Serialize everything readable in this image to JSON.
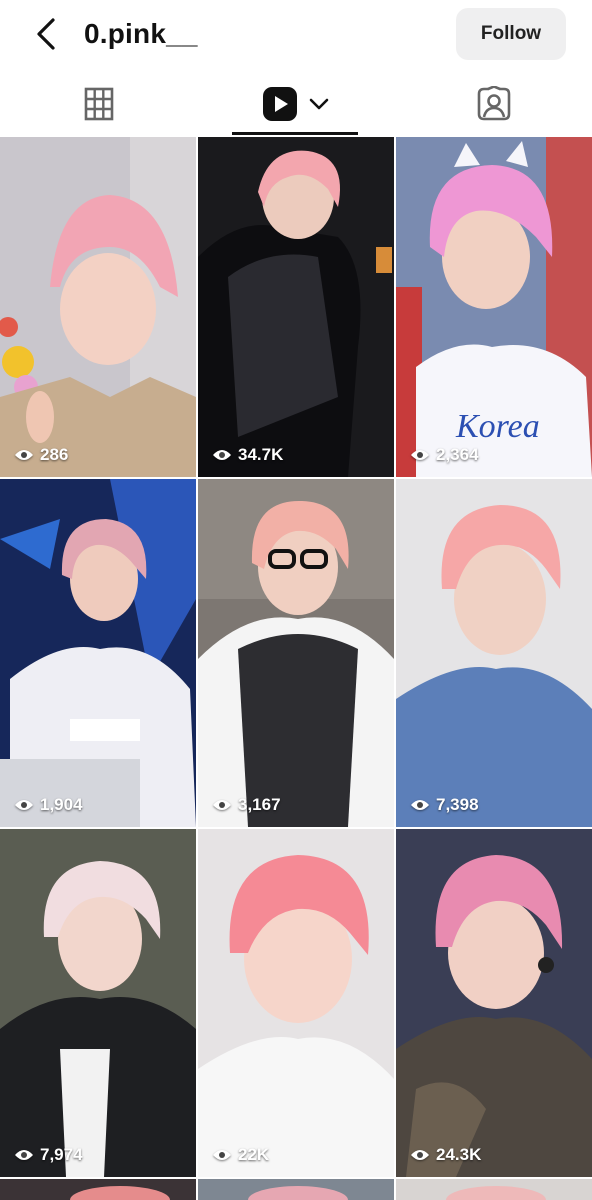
{
  "header": {
    "username": "0.pink__",
    "follow_label": "Follow"
  },
  "tabs": [
    {
      "name": "grid",
      "icon": "grid-icon"
    },
    {
      "name": "videos",
      "icon": "play-icon",
      "selected": true
    },
    {
      "name": "tagged",
      "icon": "tagged-person-icon"
    }
  ],
  "grid": {
    "items": [
      {
        "views": "286"
      },
      {
        "views": "34.7K"
      },
      {
        "views": "2,364"
      },
      {
        "views": "1,904"
      },
      {
        "views": "3,167"
      },
      {
        "views": "7,398"
      },
      {
        "views": "7,974"
      },
      {
        "views": "22K"
      },
      {
        "views": "24.3K"
      }
    ]
  }
}
